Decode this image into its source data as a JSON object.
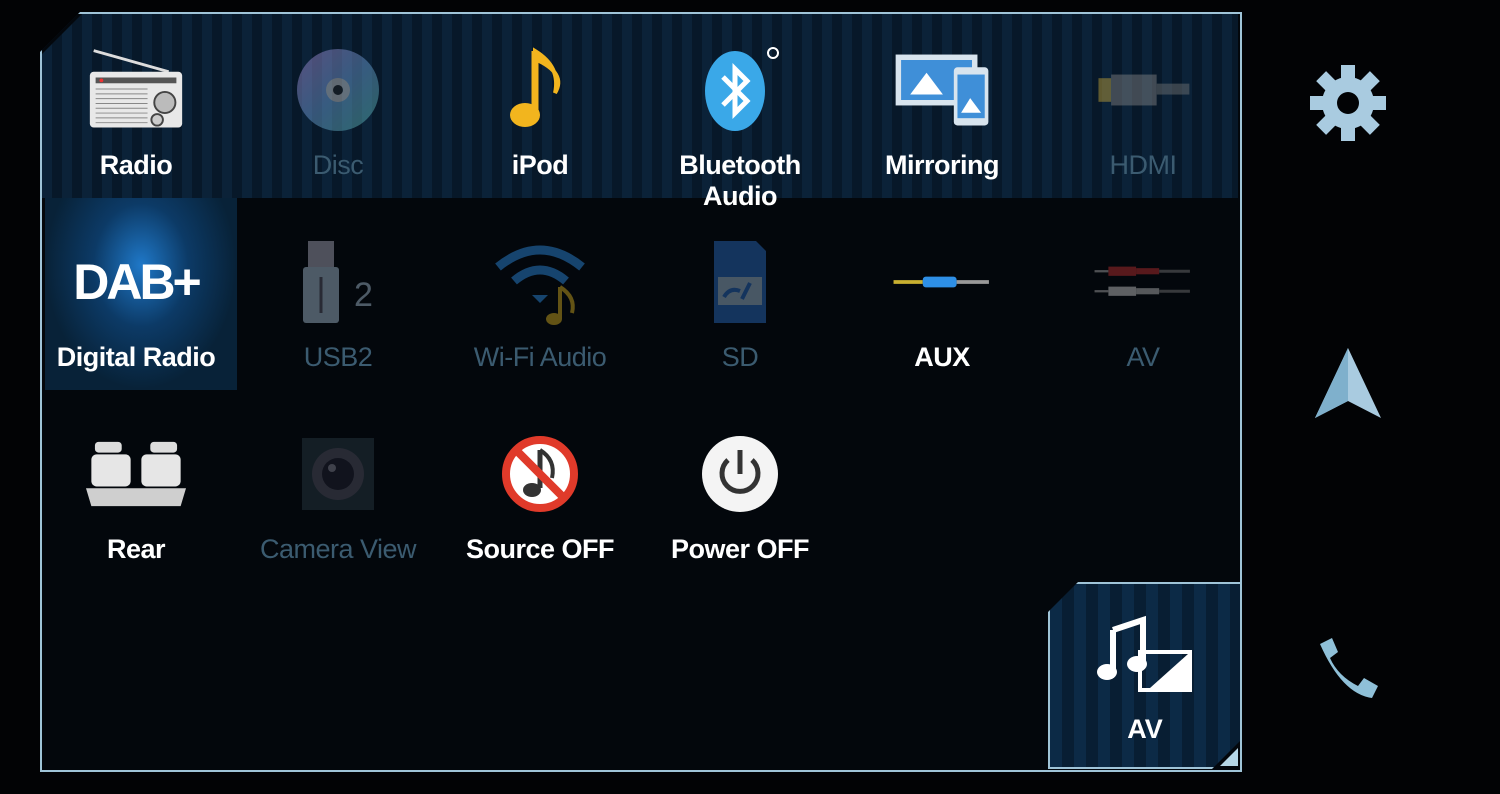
{
  "sources": [
    {
      "label": "Radio",
      "icon": "radio-icon",
      "enabled": true
    },
    {
      "label": "Disc",
      "icon": "disc-icon",
      "enabled": false
    },
    {
      "label": "iPod",
      "icon": "music-note-icon",
      "enabled": true
    },
    {
      "label": "Bluetooth Audio",
      "icon": "bluetooth-icon",
      "enabled": true
    },
    {
      "label": "Mirroring",
      "icon": "mirroring-icon",
      "enabled": true
    },
    {
      "label": "HDMI",
      "icon": "hdmi-icon",
      "enabled": false
    },
    {
      "label": "Digital Radio",
      "icon": "dab-plus-icon",
      "enabled": true,
      "selected": true,
      "icon_text": "DAB+"
    },
    {
      "label": "USB2",
      "icon": "usb-icon",
      "enabled": false,
      "icon_text": "2"
    },
    {
      "label": "Wi-Fi Audio",
      "icon": "wifi-audio-icon",
      "enabled": false
    },
    {
      "label": "SD",
      "icon": "sd-card-icon",
      "enabled": false
    },
    {
      "label": "AUX",
      "icon": "aux-cable-icon",
      "enabled": true
    },
    {
      "label": "AV",
      "icon": "rca-cable-icon",
      "enabled": false
    },
    {
      "label": "Rear",
      "icon": "rear-seats-icon",
      "enabled": true
    },
    {
      "label": "Camera View",
      "icon": "camera-icon",
      "enabled": false
    },
    {
      "label": "Source OFF",
      "icon": "source-off-icon",
      "enabled": true
    },
    {
      "label": "Power OFF",
      "icon": "power-icon",
      "enabled": true
    }
  ],
  "av_button": {
    "label": "AV",
    "icon": "av-source-icon"
  },
  "sidebar": [
    {
      "name": "settings",
      "icon": "gear-icon"
    },
    {
      "name": "navigation",
      "icon": "navigation-arrow-icon"
    },
    {
      "name": "phone",
      "icon": "phone-icon"
    }
  ],
  "colors": {
    "accent": "#1f78c8",
    "dim_label": "#3b5b70",
    "border": "#9fc4d8"
  }
}
